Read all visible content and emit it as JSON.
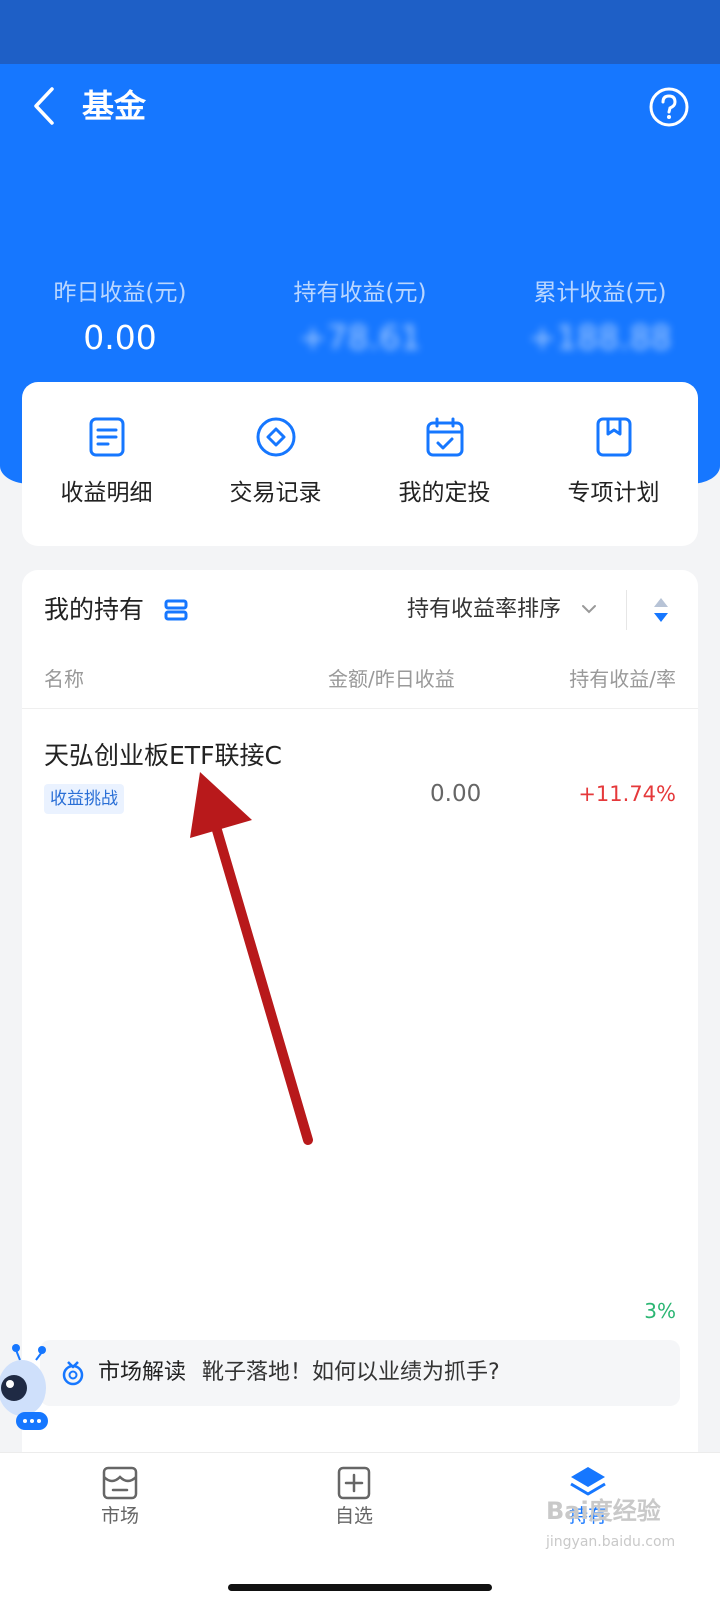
{
  "header": {
    "title": "基金"
  },
  "summary": [
    {
      "label": "昨日收益(元)",
      "value": "0.00"
    },
    {
      "label": "持有收益(元)",
      "value": "+78.61"
    },
    {
      "label": "累计收益(元)",
      "value": "+188.88"
    }
  ],
  "quick_actions": [
    {
      "label": "收益明细",
      "icon": "document-icon"
    },
    {
      "label": "交易记录",
      "icon": "diamond-circle-icon"
    },
    {
      "label": "我的定投",
      "icon": "calendar-check-icon"
    },
    {
      "label": "专项计划",
      "icon": "bookmark-icon"
    }
  ],
  "holdings": {
    "title": "我的持有",
    "sort_label": "持有收益率排序",
    "columns": {
      "name": "名称",
      "amount": "金额/昨日收益",
      "profit": "持有收益/率"
    },
    "fund": {
      "name": "天弘创业板ETF联接C",
      "tag": "收益挑战",
      "amount": "0.00",
      "rate": "+11.74%"
    },
    "partial_row": {
      "pct": "3%"
    }
  },
  "news": {
    "tag": "市场解读",
    "text": "靴子落地！如何以业绩为抓手?"
  },
  "tabbar": [
    {
      "label": "市场",
      "icon": "market-icon"
    },
    {
      "label": "自选",
      "icon": "add-watchlist-icon"
    },
    {
      "label": "持有",
      "icon": "layers-icon"
    }
  ],
  "watermark": {
    "brand": "Bai度经验",
    "url": "jingyan.baidu.com"
  },
  "colors": {
    "primary": "#1677ff",
    "rise": "#e5393b",
    "fall": "#2bb673",
    "arrow": "#b8191b"
  }
}
